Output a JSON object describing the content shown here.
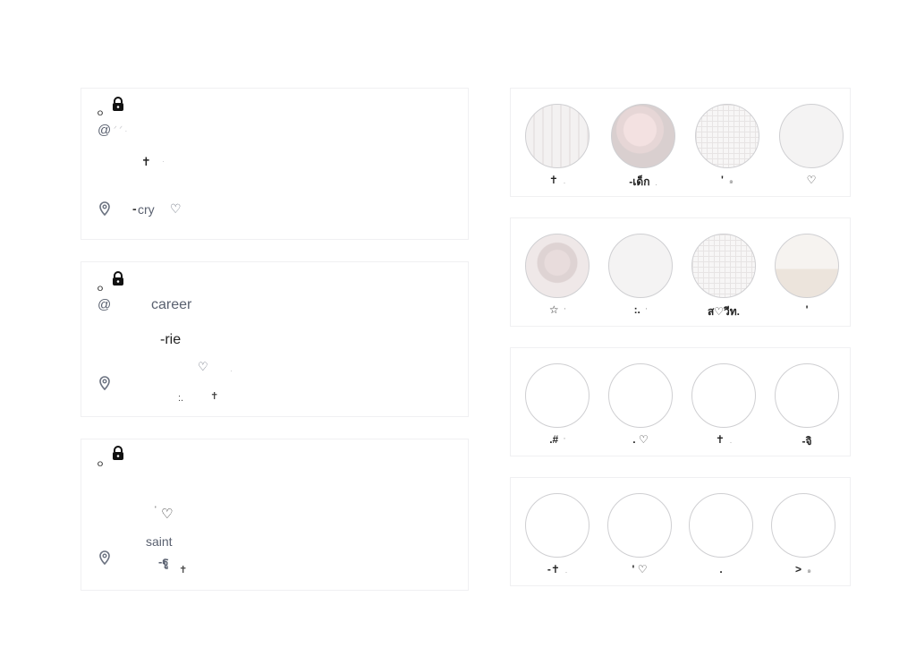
{
  "profile_cards": [
    {
      "small_mark": "ｏ",
      "handle_at": "@",
      "handle_tail": "ᐟ ᐟ .",
      "bio_cross": "✝",
      "bio_dot": "·",
      "location": "꒰ -cry ♡",
      "loc_prefix": "-",
      "loc_name": "cry",
      "loc_heart": "♡"
    },
    {
      "small_mark": "ｏ",
      "handle_at": "@",
      "handle_name": "career",
      "bio_name": "-rie",
      "bio_heart": "♡",
      "bio_dot": "·",
      "location_marks": ":.",
      "location_cross": "✝"
    },
    {
      "small_mark": "ｏ",
      "bio_heart": "♡",
      "bio_dot": "'",
      "loc_name": "saint",
      "loc_sub": "-ฐู",
      "loc_cross": "✝"
    }
  ],
  "highlight_rows": [
    {
      "items": [
        {
          "label": "✝",
          "tail": ".",
          "fill": "stripe"
        },
        {
          "label": "-เด็ก",
          "tail": ".",
          "fill": "photo-pink"
        },
        {
          "label": "'",
          "tail": "๑",
          "fill": "grid"
        },
        {
          "label": "♡",
          "tail": "",
          "fill": "soft"
        }
      ]
    },
    {
      "items": [
        {
          "label": "☆",
          "tail": "'",
          "fill": "photo-bear"
        },
        {
          "label": ":.",
          "tail": "'",
          "fill": "soft"
        },
        {
          "label": "ส♡วีท.",
          "tail": "",
          "fill": "grid"
        },
        {
          "label": "'",
          "tail": "",
          "fill": "photo-teddy"
        }
      ]
    },
    {
      "items": [
        {
          "label": ".#",
          "tail": "'",
          "fill": "plain"
        },
        {
          "label": ". ♡",
          "tail": "",
          "fill": "plain"
        },
        {
          "label": "✝",
          "tail": ".",
          "fill": "plain"
        },
        {
          "label": "-จิ",
          "tail": "",
          "fill": "plain"
        }
      ]
    },
    {
      "items": [
        {
          "label": "-✝",
          "tail": ".",
          "fill": "plain"
        },
        {
          "label": "' ♡",
          "tail": "",
          "fill": "plain"
        },
        {
          "label": ".",
          "tail": "",
          "fill": "plain"
        },
        {
          "label": ">",
          "tail": "๑",
          "fill": "plain"
        }
      ]
    }
  ],
  "colors": {
    "border": "#f0f0f2",
    "circle_border": "#cfcfd2",
    "muted_text": "#5a6170"
  },
  "icons": {
    "lock": "lock-icon",
    "location": "map-pin-icon"
  }
}
